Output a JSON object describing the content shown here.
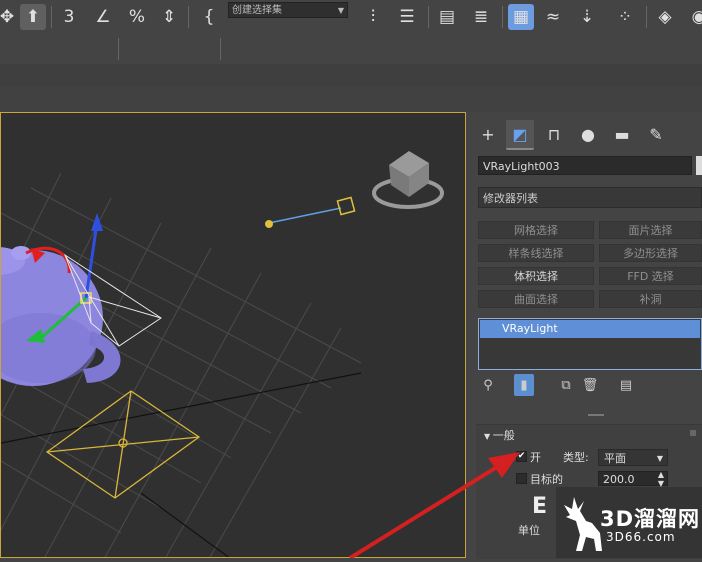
{
  "toolbar_main": {
    "selection_set": "创建选择集"
  },
  "panel": {
    "object_name": "VRayLight003",
    "modifier_list_label": "修改器列表",
    "modifier_buttons": [
      {
        "label": "网格选择",
        "enabled": false
      },
      {
        "label": "面片选择",
        "enabled": false
      },
      {
        "label": "样条线选择",
        "enabled": false
      },
      {
        "label": "多边形选择",
        "enabled": false
      },
      {
        "label": "体积选择",
        "enabled": true
      },
      {
        "label": "FFD 选择",
        "enabled": false
      },
      {
        "label": "曲面选择",
        "enabled": false
      },
      {
        "label": "补洞",
        "enabled": false
      }
    ],
    "stack_item": "VRayLight",
    "rollout": {
      "title": "一般",
      "on_label": "开",
      "on_checked": true,
      "type_label": "类型:",
      "type_value": "平面",
      "target_label": "目标的",
      "target_checked": false,
      "target_value": "200.0",
      "units_label": "单位"
    }
  },
  "watermark": {
    "text": "3D溜溜网",
    "url_text": "3D66.com"
  },
  "colors": {
    "background": "#444444",
    "viewport": "#303030",
    "accent_blue": "#5c8fd0",
    "selection_yellow": "#c9a53c",
    "arrow_red": "#d42020"
  }
}
